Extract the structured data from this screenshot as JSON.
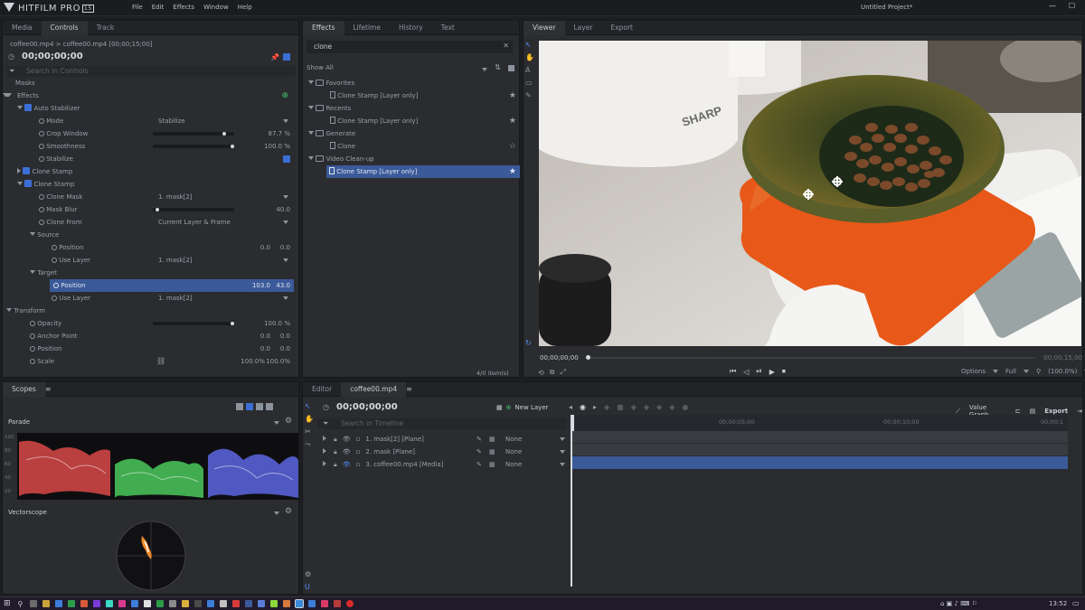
{
  "app": {
    "logo": "HITFILM PRO",
    "version": "15",
    "project": "Untitled Project*",
    "menu": [
      "File",
      "Edit",
      "Effects",
      "Window",
      "Help"
    ]
  },
  "left_panel": {
    "tabs": [
      "Media",
      "Controls",
      "Track"
    ],
    "clip": "coffee00.mp4 > coffee00.mp4 [00;00;15;00]",
    "timecode": "00;00;00;00",
    "search_placeholder": "Search in Controls",
    "rows": [
      {
        "label": "Masks",
        "indent": 0
      },
      {
        "label": "Effects",
        "indent": 0
      },
      {
        "label": "Auto Stabilizer",
        "indent": 1
      },
      {
        "label": "Mode",
        "indent": 2,
        "value": "Stabilize"
      },
      {
        "label": "Crop Window",
        "indent": 2,
        "value": "87.7 %"
      },
      {
        "label": "Smoothness",
        "indent": 2,
        "value": "100.0 %"
      },
      {
        "label": "Stabilize",
        "indent": 2
      },
      {
        "label": "Clone Stamp",
        "indent": 1
      },
      {
        "label": "Clone Stamp",
        "indent": 1
      },
      {
        "label": "Clone Mask",
        "indent": 2,
        "value": "1. mask[2]"
      },
      {
        "label": "Mask Blur",
        "indent": 2,
        "value": "40.0"
      },
      {
        "label": "Clone From",
        "indent": 2,
        "value": "Current Layer & Frame"
      },
      {
        "label": "Source",
        "indent": 2
      },
      {
        "label": "Position",
        "indent": 3,
        "v1": "0.0",
        "v2": "0.0"
      },
      {
        "label": "Use Layer",
        "indent": 3,
        "value": "1. mask[2]"
      },
      {
        "label": "Target",
        "indent": 2
      },
      {
        "label": "Position",
        "indent": 3,
        "v1": "103.0",
        "v2": "43.0"
      },
      {
        "label": "Use Layer",
        "indent": 3,
        "value": "1. mask[2]"
      },
      {
        "label": "Transform",
        "indent": 0
      },
      {
        "label": "Opacity",
        "indent": 2,
        "value": "100.0 %"
      },
      {
        "label": "Anchor Point",
        "indent": 2,
        "v1": "0.0",
        "v2": "0.0"
      },
      {
        "label": "Position",
        "indent": 2,
        "v1": "0.0",
        "v2": "0.0"
      },
      {
        "label": "Scale",
        "indent": 2,
        "v1": "100.0%",
        "v2": "100.0%"
      }
    ],
    "crop_window_level": 0.877,
    "smoothness_level": 1.0,
    "mask_blur_level": 0.05,
    "opacity_level": 1.0
  },
  "effects_panel": {
    "tabs": [
      "Effects",
      "Lifetime",
      "History",
      "Text"
    ],
    "search": "clone",
    "filter": "Show All",
    "tree": [
      {
        "label": "Favorites",
        "type": "folder"
      },
      {
        "label": "Clone Stamp [Layer only]",
        "type": "item"
      },
      {
        "label": "Recents",
        "type": "folder"
      },
      {
        "label": "Clone Stamp [Layer only]",
        "type": "item"
      },
      {
        "label": "Generate",
        "type": "folder"
      },
      {
        "label": "Clone",
        "type": "item"
      },
      {
        "label": "Video Clean-up",
        "type": "folder"
      },
      {
        "label": "Clone Stamp [Layer only]",
        "type": "item"
      }
    ],
    "count": "4/0 item(s)"
  },
  "viewer": {
    "tabs": [
      "Viewer",
      "Layer",
      "Export"
    ],
    "time_left": "00;00;00;00",
    "time_right": "00;00;15;00",
    "options": "Options",
    "full": "Full",
    "zoom": "(100.0%)",
    "scale_brand": "SHARP"
  },
  "scopes": {
    "tab": "Scopes",
    "parade": "Parade",
    "vectorscope": "Vectorscope",
    "axis": [
      "100",
      "80",
      "60",
      "40",
      "20",
      "0"
    ]
  },
  "timeline": {
    "tabs": [
      "Editor",
      "coffee00.mp4"
    ],
    "timecode": "00;00;00;00",
    "new_layer": "New Layer",
    "value_graph": "Value Graph",
    "export": "Export",
    "search_placeholder": "Search in Timeline",
    "ruler": [
      "00;00;05;00",
      "00;00;10;00",
      "00;00;1"
    ],
    "layers": [
      {
        "name": "1. mask[2] [Plane]",
        "blend": "None"
      },
      {
        "name": "2. mask [Plane]",
        "blend": "None"
      },
      {
        "name": "3. coffee00.mp4 [Media]",
        "blend": "None"
      }
    ]
  },
  "taskbar": {
    "time": "13:52"
  }
}
